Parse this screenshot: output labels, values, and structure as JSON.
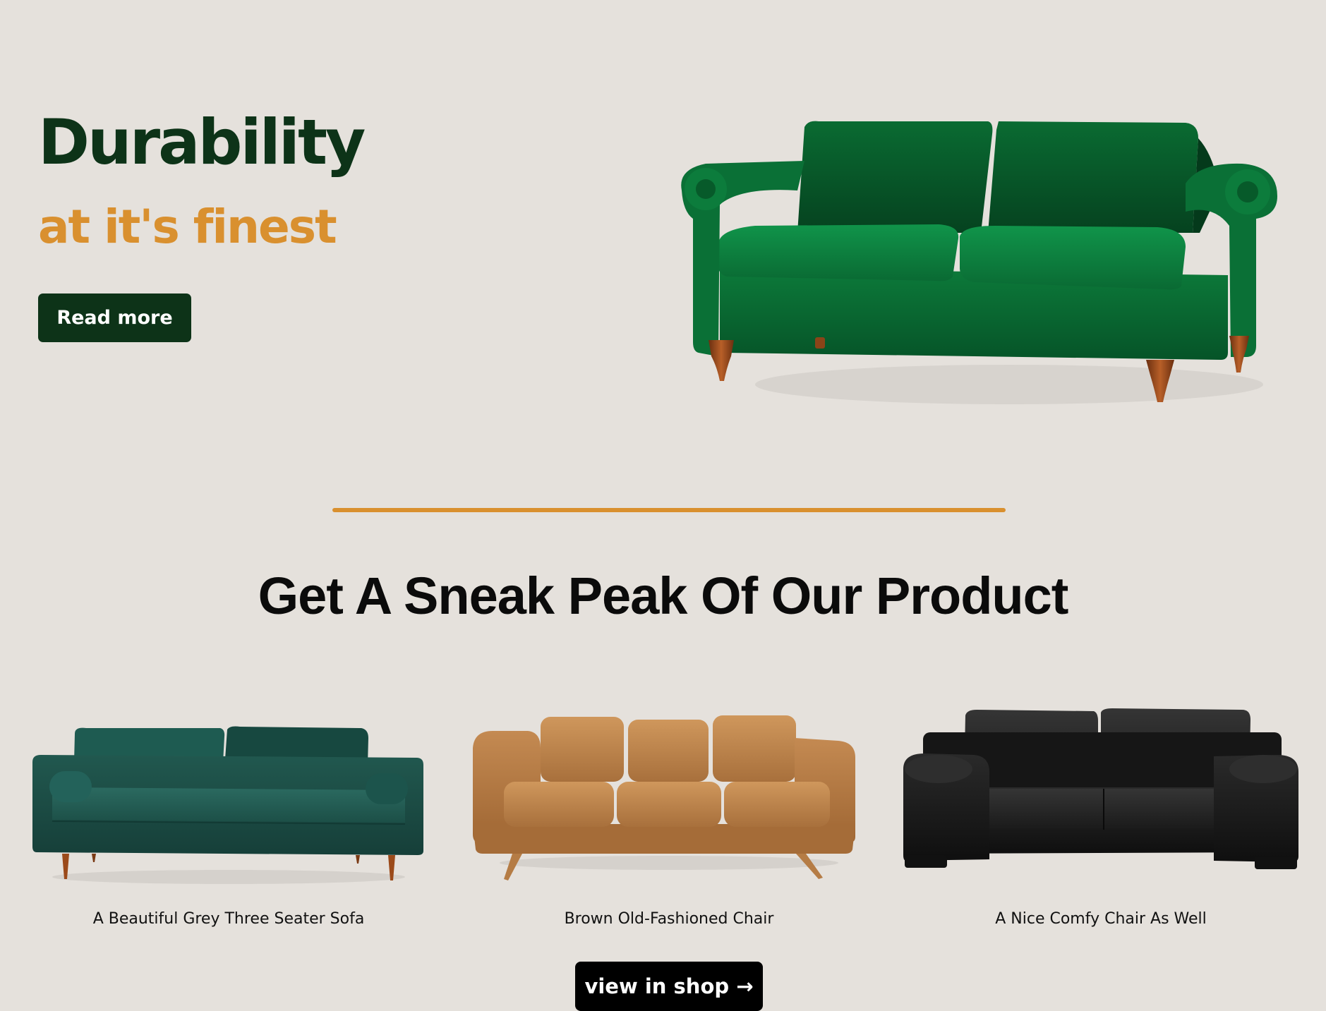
{
  "hero": {
    "title": "Durability",
    "subtitle": "at it's finest",
    "cta_label": "Read more",
    "title_color": "#0d3318",
    "accent_color": "#d9902f"
  },
  "section": {
    "title": "Get A Sneak Peak Of Our Product"
  },
  "products": [
    {
      "caption": "A Beautiful Grey Three Seater Sofa",
      "color": "#1f524a",
      "icon": "teal-sofa-image"
    },
    {
      "caption": "Brown Old-Fashioned Chair",
      "color": "#b57c45",
      "icon": "tan-leather-sofa-image"
    },
    {
      "caption": "A Nice Comfy Chair As Well",
      "color": "#1c1c1c",
      "icon": "black-leather-sofa-image"
    }
  ],
  "shop_button": {
    "label": "view in shop →"
  },
  "colors": {
    "background": "#e5e1dc",
    "dark_green": "#0d3318",
    "accent": "#d9902f",
    "black": "#000000"
  }
}
